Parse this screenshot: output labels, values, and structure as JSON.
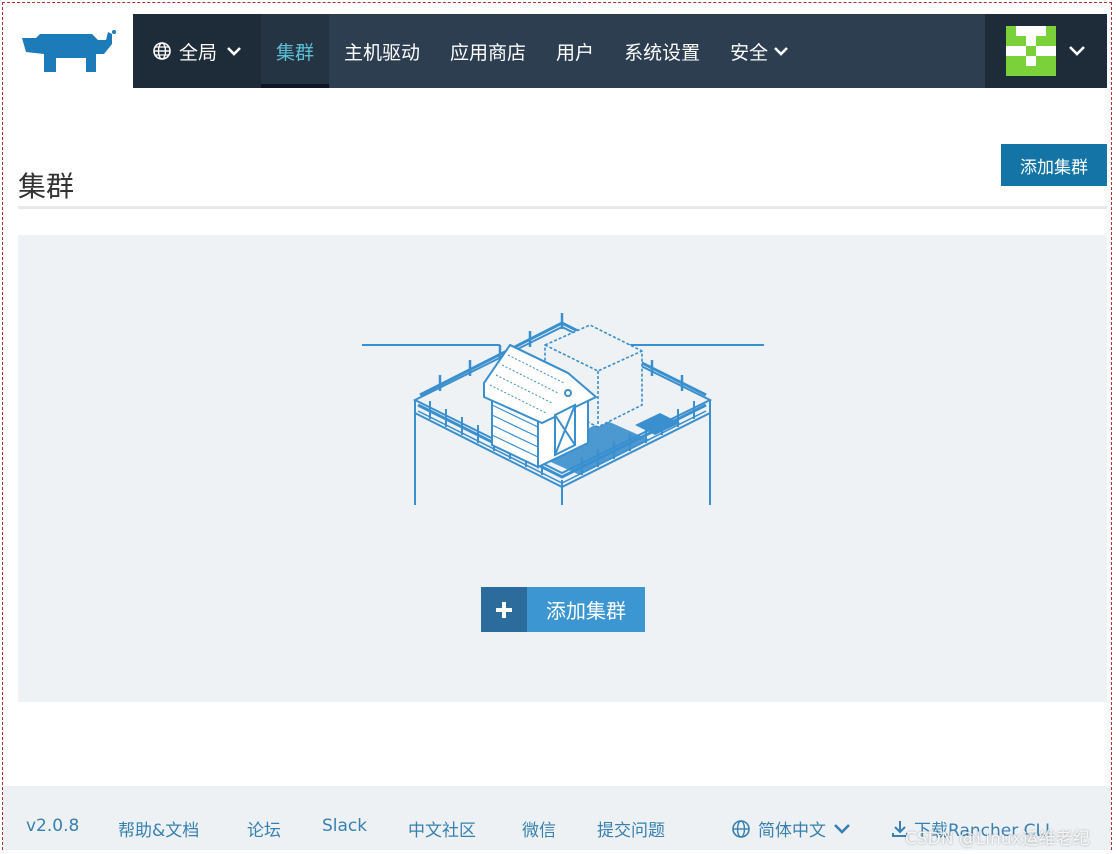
{
  "brand": {
    "accent": "#3c96d1",
    "nav_bg": "#2d3e50",
    "nav_dark": "#1e2b38",
    "active_text": "#5bbfd6",
    "button_bg": "#1474a5"
  },
  "nav": {
    "global_label": "全局",
    "items": [
      {
        "label": "集群",
        "active": true
      },
      {
        "label": "主机驱动"
      },
      {
        "label": "应用商店"
      },
      {
        "label": "用户"
      },
      {
        "label": "系统设置"
      },
      {
        "label": "安全",
        "has_dropdown": true
      }
    ],
    "avatar_icon": "identicon-avatar"
  },
  "page": {
    "title": "集群",
    "add_button": "添加集群"
  },
  "empty_state": {
    "illustration_icon": "farm-barn-illustration",
    "cta_label": "添加集群",
    "cta_icon": "plus-icon"
  },
  "footer": {
    "version": "v2.0.8",
    "help": "帮助&文档",
    "forum": "论坛",
    "slack": "Slack",
    "community": "中文社区",
    "wechat": "微信",
    "issue": "提交问题",
    "language": "简体中文",
    "download": "下载Rancher CLI"
  },
  "watermark": "CSDN @Linux运维老纪"
}
